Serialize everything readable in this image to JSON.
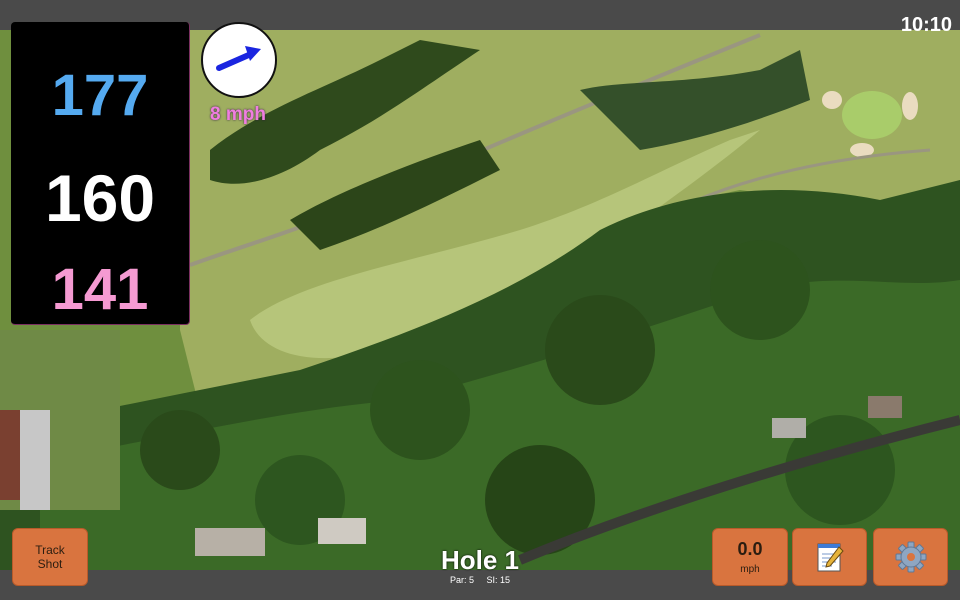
{
  "status_bar": {
    "time": "10:10"
  },
  "distances": {
    "back": "177",
    "middle": "160",
    "front": "141",
    "colors": {
      "back": "#55aaf0",
      "middle": "#ffffff",
      "front": "#f59ad2"
    }
  },
  "wind": {
    "icon": "arrow-right-icon",
    "speed_label": "8 mph"
  },
  "buttons": {
    "track_shot_line1": "Track",
    "track_shot_line2": "Shot",
    "wind_value": "0.0",
    "wind_unit": "mph",
    "notes_icon": "notepad-icon",
    "settings_icon": "gear-icon",
    "accent": "#d9743f"
  },
  "hole": {
    "title": "Hole 1",
    "par": "Par: 5",
    "si": "SI: 15"
  }
}
